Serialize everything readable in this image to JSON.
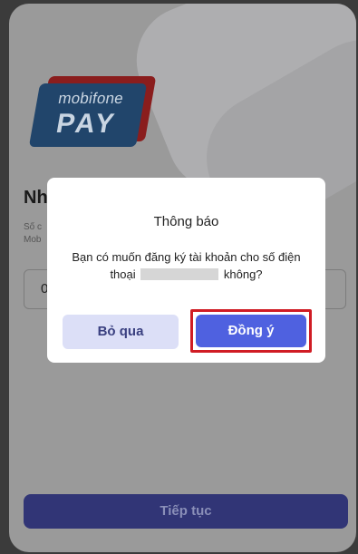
{
  "logo": {
    "line1": "mobifone",
    "line2": "PAY"
  },
  "page": {
    "heading": "Nh",
    "description_line1": "Số c",
    "description_line2": "Mob",
    "phone_input_value": "0",
    "continue_label": "Tiếp tục"
  },
  "dialog": {
    "title": "Thông báo",
    "message_part1": "Bạn có muốn đăng ký tài khoản cho số điện thoại",
    "message_part2": "không?",
    "skip_label": "Bỏ qua",
    "agree_label": "Đồng ý"
  },
  "colors": {
    "primary": "#4f61e0",
    "highlight_border": "#d01c24",
    "secondary_button": "#dcdff7",
    "continue_button": "#313576"
  }
}
